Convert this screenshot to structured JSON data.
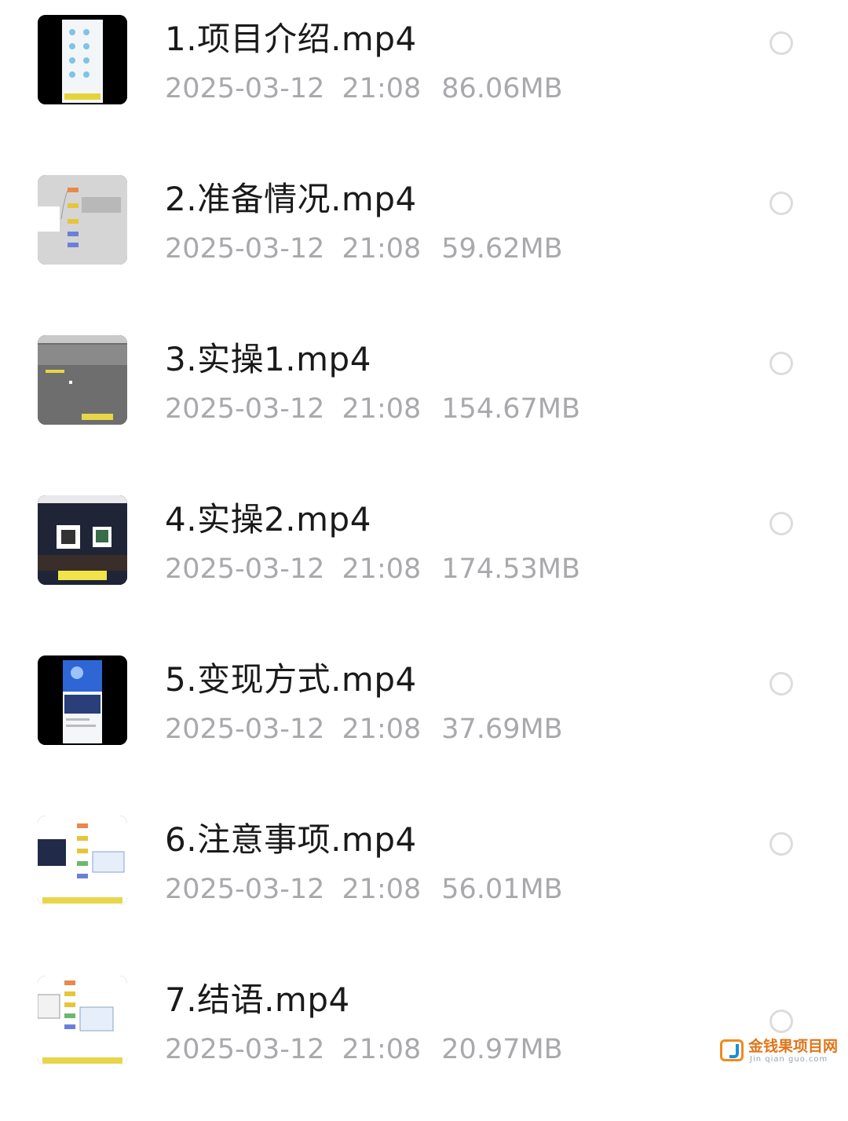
{
  "files": [
    {
      "name": "1.项目介绍.mp4",
      "date": "2025-03-12",
      "time": "21:08",
      "size": "86.06MB",
      "thumb": "phone-app-screens-thumbnail"
    },
    {
      "name": "2.准备情况.mp4",
      "date": "2025-03-12",
      "time": "21:08",
      "size": "59.62MB",
      "thumb": "mindmap-gray-thumbnail"
    },
    {
      "name": "3.实操1.mp4",
      "date": "2025-03-12",
      "time": "21:08",
      "size": "154.67MB",
      "thumb": "desktop-gray-thumbnail"
    },
    {
      "name": "4.实操2.mp4",
      "date": "2025-03-12",
      "time": "21:08",
      "size": "174.53MB",
      "thumb": "city-night-qr-thumbnail"
    },
    {
      "name": "5.变现方式.mp4",
      "date": "2025-03-12",
      "time": "21:08",
      "size": "37.69MB",
      "thumb": "blue-webpage-thumbnail"
    },
    {
      "name": "6.注意事项.mp4",
      "date": "2025-03-12",
      "time": "21:08",
      "size": "56.01MB",
      "thumb": "mindmap-white-thumbnail"
    },
    {
      "name": "7.结语.mp4",
      "date": "2025-03-12",
      "time": "21:08",
      "size": "20.97MB",
      "thumb": "mindmap-white-thumbnail"
    }
  ],
  "watermark": {
    "title": "金钱果项目网",
    "subtitle": "Jin qian guo.com"
  },
  "colors": {
    "name": "#1a1a1a",
    "meta": "#a9a9ad",
    "radio_border": "#dcdcdc",
    "watermark": "#e0761a"
  }
}
